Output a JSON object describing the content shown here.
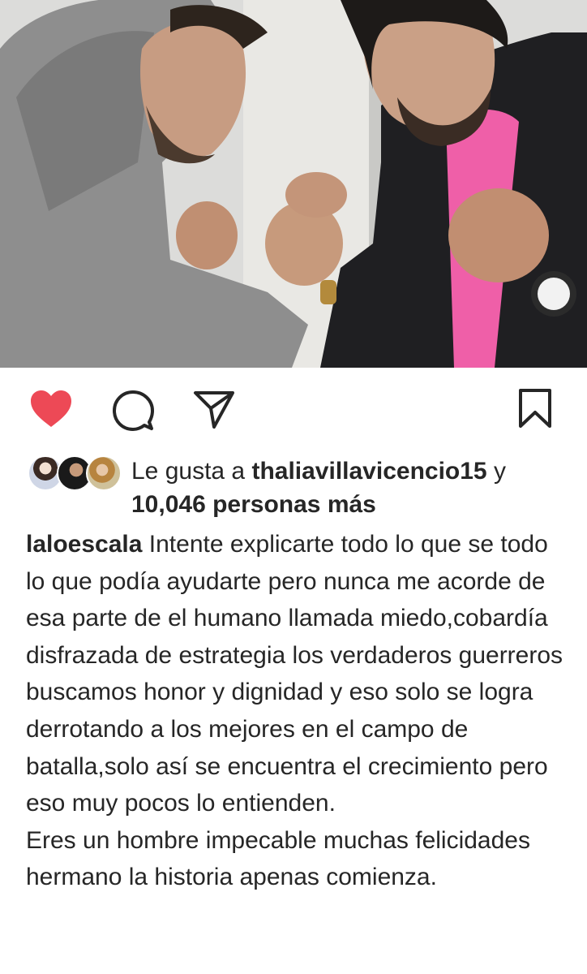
{
  "post": {
    "image_alt": "",
    "actions": {
      "like_icon": "heart-filled-icon",
      "like_color": "#ed4956",
      "comment_icon": "comment-icon",
      "share_icon": "paper-plane-icon",
      "save_icon": "bookmark-icon"
    },
    "likes": {
      "prefix": "Le gusta a ",
      "user": "thaliavillavicencio15",
      "connector": " y ",
      "count_text": "10,046 personas más"
    },
    "caption": {
      "username": "laloescala",
      "text": "Intente explicarte todo lo que se todo lo que podía ayudarte pero nunca me acorde de esa parte de el humano llamada miedo,cobardía disfrazada de estrategia los verdaderos guerreros buscamos honor y dignidad y eso solo se logra derrotando a los mejores en el campo de batalla,solo así se encuentra el crecimiento pero eso muy pocos lo entienden.\nEres un hombre impecable muchas felicidades hermano la historia apenas comienza."
    }
  }
}
